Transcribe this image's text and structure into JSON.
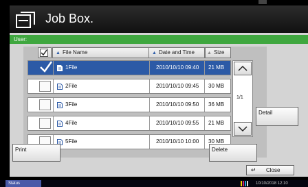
{
  "app": {
    "title": "Job Box."
  },
  "user": {
    "label": "User:"
  },
  "table": {
    "headers": {
      "name": "File Name",
      "date": "Date and Time",
      "size": "Size"
    },
    "rows": [
      {
        "name": "1File",
        "date": "2010/10/10 09:40",
        "size": "21 MB",
        "selected": true
      },
      {
        "name": "2File",
        "date": "2010/10/10 09:45",
        "size": "30 MB",
        "selected": false
      },
      {
        "name": "3File",
        "date": "2010/10/10 09:50",
        "size": "36 MB",
        "selected": false
      },
      {
        "name": "4File",
        "date": "2010/10/10 09:55",
        "size": "21 MB",
        "selected": false
      },
      {
        "name": "5File",
        "date": "2010/10/10 10:00",
        "size": "30 MB",
        "selected": false
      }
    ]
  },
  "pager": {
    "page": "1/1"
  },
  "buttons": {
    "detail": "Detail",
    "print": "Print",
    "delete": "Delete",
    "close": "Close"
  },
  "status": {
    "label": "Status",
    "datetime": "10/10/2018 12:10"
  },
  "colors": {
    "accent_green": "#3fa73f",
    "selected_row": "#2c5aa6",
    "status_blue": "#4a5aa8"
  }
}
